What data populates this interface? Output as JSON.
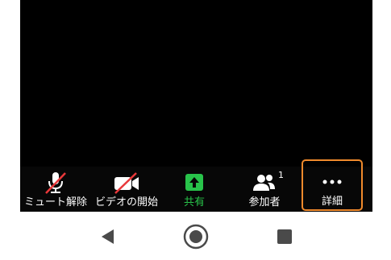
{
  "toolbar": {
    "unmute": {
      "label": "ミュート解除",
      "icon": "microphone-muted-icon"
    },
    "start_video": {
      "label": "ビデオの開始",
      "icon": "video-camera-off-icon"
    },
    "share": {
      "label": "共有",
      "icon": "share-arrow-up-icon"
    },
    "participants": {
      "label": "参加者",
      "icon": "participants-icon",
      "count": "1"
    },
    "more": {
      "label": "詳細",
      "icon": "more-dots-icon"
    }
  },
  "navbar": {
    "back": {
      "icon": "back-triangle-icon"
    },
    "home": {
      "icon": "home-circle-icon"
    },
    "recents": {
      "icon": "recents-square-icon"
    }
  },
  "colors": {
    "screen_background": "#000000",
    "toolbar_background": "#070707",
    "share_green": "#28c34a",
    "mute_slash_red": "#e8383a",
    "highlight_orange": "#f08a2c",
    "nav_icon": "#4a4a4a"
  }
}
